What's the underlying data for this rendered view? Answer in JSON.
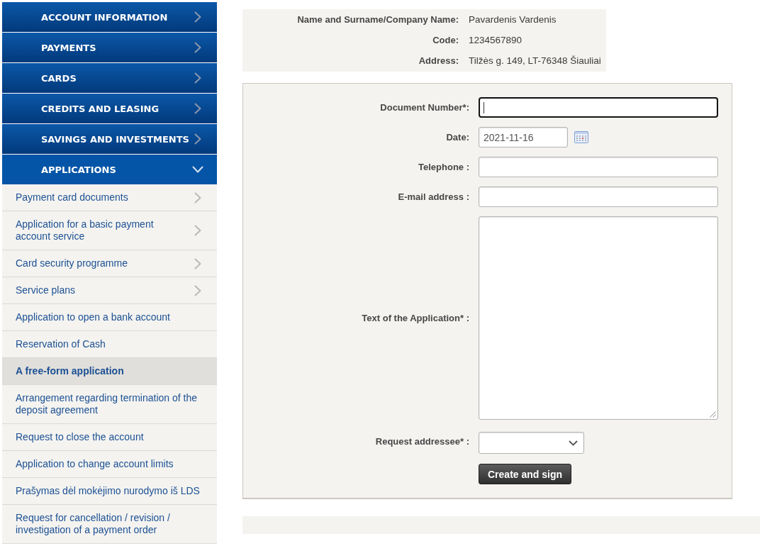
{
  "sidebar": {
    "sections": [
      {
        "label": "ACCOUNT INFORMATION",
        "expanded": false
      },
      {
        "label": "PAYMENTS",
        "expanded": false
      },
      {
        "label": "CARDS",
        "expanded": false
      },
      {
        "label": "CREDITS AND LEASING",
        "expanded": false
      },
      {
        "label": "SAVINGS AND INVESTMENTS",
        "expanded": false
      },
      {
        "label": "APPLICATIONS",
        "expanded": true,
        "items": [
          {
            "label": "Payment card documents",
            "has_submenu": true,
            "selected": false
          },
          {
            "label": "Application for a basic payment account service",
            "has_submenu": true,
            "selected": false
          },
          {
            "label": "Card security programme",
            "has_submenu": true,
            "selected": false
          },
          {
            "label": "Service plans",
            "has_submenu": true,
            "selected": false
          },
          {
            "label": "Application to open a bank account",
            "has_submenu": false,
            "selected": false
          },
          {
            "label": "Reservation of Cash",
            "has_submenu": false,
            "selected": false
          },
          {
            "label": "A free-form application",
            "has_submenu": false,
            "selected": true
          },
          {
            "label": "Arrangement regarding termination of the deposit agreement",
            "has_submenu": false,
            "selected": false
          },
          {
            "label": "Request to close the account",
            "has_submenu": false,
            "selected": false
          },
          {
            "label": "Application to change account limits",
            "has_submenu": false,
            "selected": false
          },
          {
            "label": "Prašymas dėl mokėjimo nurodymo iš LDS",
            "has_submenu": false,
            "selected": false
          },
          {
            "label": "Request for cancellation / revision / investigation of a payment order",
            "has_submenu": false,
            "selected": false
          }
        ]
      }
    ]
  },
  "customer": {
    "fields": [
      {
        "label": "Name and Surname/Company Name:",
        "value": "Pavardenis Vardenis"
      },
      {
        "label": "Code:",
        "value": "1234567890"
      },
      {
        "label": "Address:",
        "value": "Tilžės g. 149, LT-76348 Šiauliai"
      }
    ]
  },
  "form": {
    "fields": [
      {
        "kind": "text",
        "label": "Document Number*:",
        "focused": true
      },
      {
        "kind": "date",
        "label": "Date:",
        "value": "2021-11-16",
        "focused": false
      },
      {
        "kind": "text",
        "label": "Telephone :",
        "focused": false
      },
      {
        "kind": "text",
        "label": "E-mail address :",
        "focused": false
      },
      {
        "kind": "textarea",
        "label": "Text of the Application* :",
        "focused": false
      },
      {
        "kind": "select",
        "label": "Request addressee* :",
        "focused": false
      }
    ],
    "submit_button": "Create and sign"
  }
}
